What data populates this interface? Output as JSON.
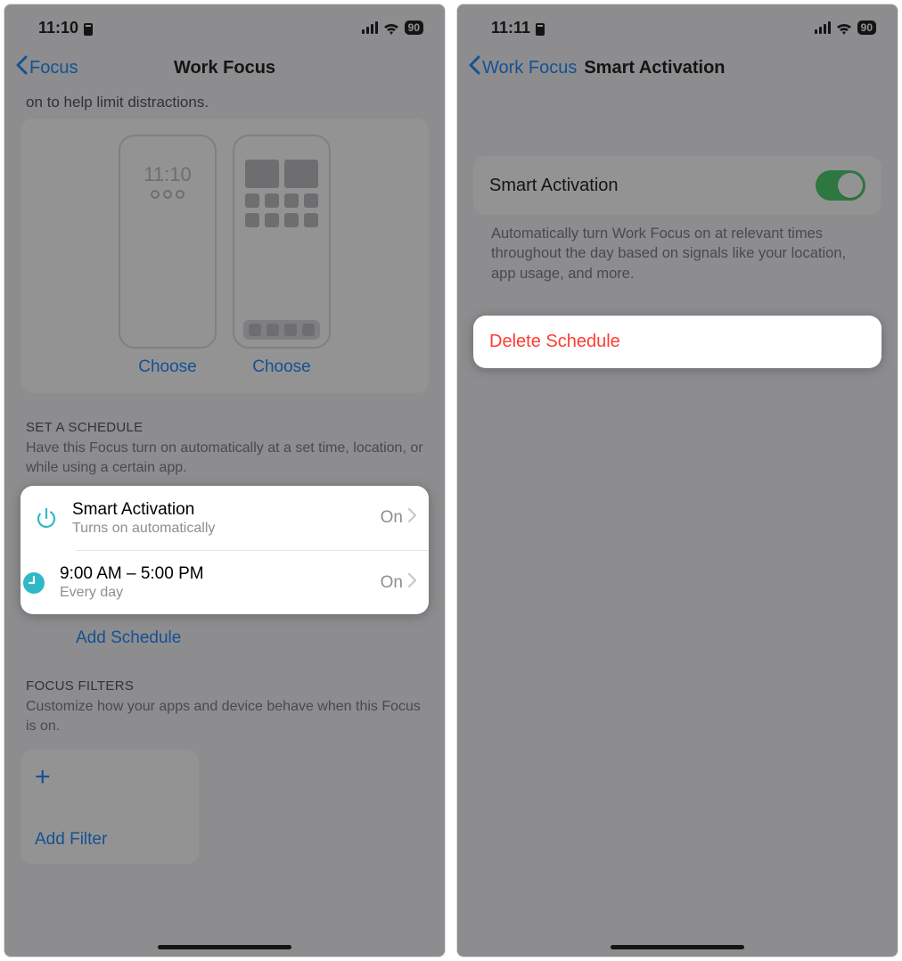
{
  "left": {
    "status_time": "11:10",
    "battery": "90",
    "back_label": "Focus",
    "nav_title": "Work Focus",
    "intro_tail": "on to help limit distractions.",
    "mock_time": "11:10",
    "choose_label": "Choose",
    "schedule_header": "SET A SCHEDULE",
    "schedule_desc": "Have this Focus turn on automatically at a set time, location, or while using a certain app.",
    "rows": [
      {
        "title": "Smart Activation",
        "sub": "Turns on automatically",
        "trail": "On"
      },
      {
        "title": "9:00 AM – 5:00 PM",
        "sub": "Every day",
        "trail": "On"
      }
    ],
    "add_schedule": "Add Schedule",
    "filters_header": "FOCUS FILTERS",
    "filters_desc": "Customize how your apps and device behave when this Focus is on.",
    "add_filter": "Add Filter"
  },
  "right": {
    "status_time": "11:11",
    "battery": "90",
    "back_label": "Work Focus",
    "nav_title": "Smart Activation",
    "toggle_label": "Smart Activation",
    "toggle_on": true,
    "desc": "Automatically turn Work Focus on at relevant times throughout the day based on signals like your location, app usage, and more.",
    "delete_label": "Delete Schedule"
  }
}
